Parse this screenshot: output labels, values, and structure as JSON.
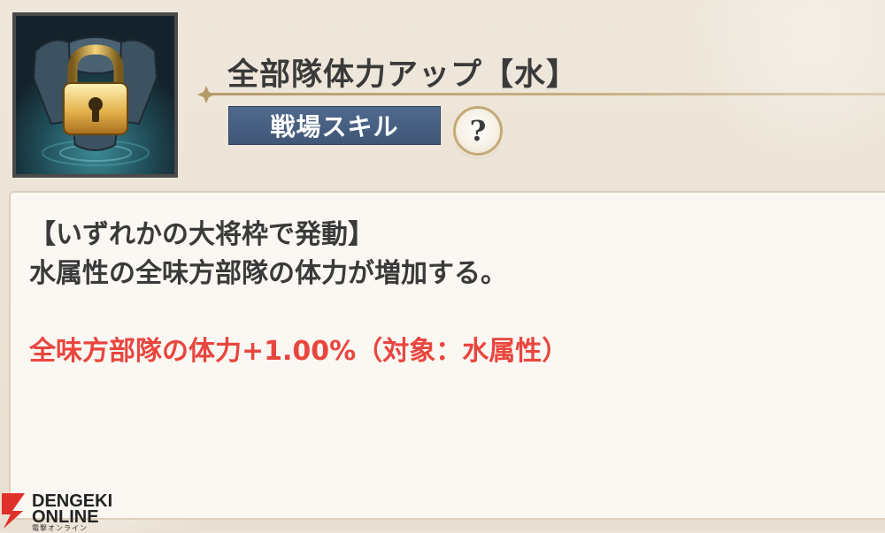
{
  "skill": {
    "title": "全部隊体力アップ【水】",
    "category_tag": "戦場スキル",
    "help_label": "?",
    "locked": true
  },
  "description": {
    "trigger": "【いずれかの大将枠で発動】",
    "text": "水属性の全味方部隊の体力が増加する。",
    "effect": "全味方部隊の体力+1.00%（対象：水属性）"
  },
  "watermark": {
    "line1": "DENGEKI",
    "line2": "ONLINE",
    "sub": "電撃オンライン"
  },
  "colors": {
    "background": "#ece3d6",
    "tag": "#4a6184",
    "effect_text": "#e8463e",
    "icon_frame": "#4a4a4a"
  },
  "icons": [
    "lock-icon",
    "armor-icon",
    "help-icon",
    "dengeki-logo-icon"
  ]
}
